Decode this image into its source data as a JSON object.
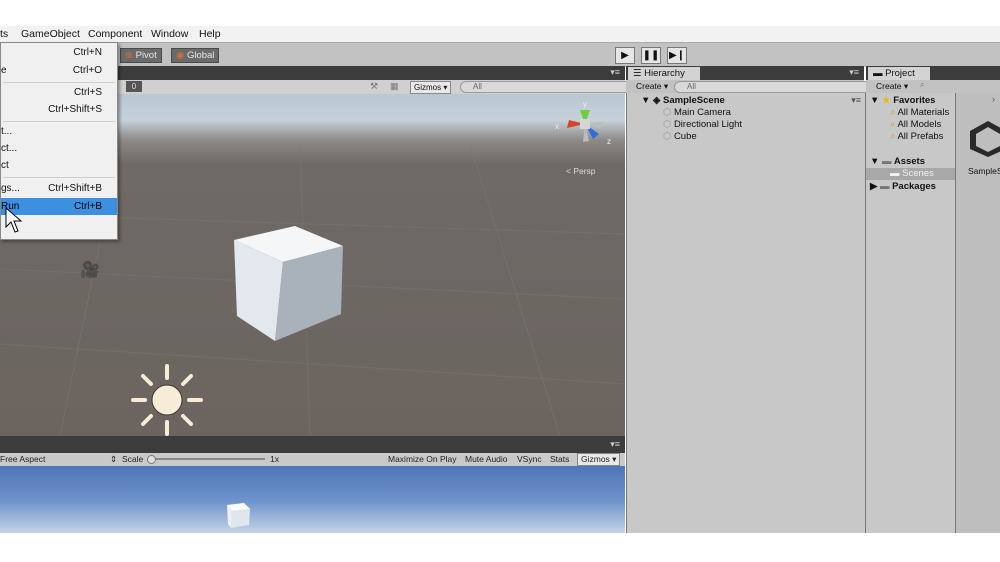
{
  "menubar": {
    "items": [
      "ts",
      "GameObject",
      "Component",
      "Window",
      "Help"
    ]
  },
  "toolbar": {
    "pivot_label": "Pivot",
    "global_label": "Global"
  },
  "file_menu": {
    "items": [
      {
        "label": "",
        "shortcut": "Ctrl+N"
      },
      {
        "label": "e",
        "shortcut": "Ctrl+O"
      },
      {
        "label": "",
        "shortcut": "Ctrl+S"
      },
      {
        "label": "",
        "shortcut": "Ctrl+Shift+S"
      },
      {
        "label": "t...",
        "shortcut": ""
      },
      {
        "label": "ct...",
        "shortcut": ""
      },
      {
        "label": "ct",
        "shortcut": ""
      },
      {
        "label": "gs...",
        "shortcut": "Ctrl+Shift+B"
      },
      {
        "label": "Run",
        "shortcut": "Ctrl+B"
      }
    ]
  },
  "scene": {
    "toolbar_field": "0",
    "gizmos_label": "Gizmos",
    "search_placeholder": "All",
    "persp_label": "< Persp",
    "axis_y": "y",
    "axis_x": "x",
    "axis_z": "z"
  },
  "game": {
    "aspect": "Free Aspect",
    "scale_label": "Scale",
    "scale_value": "1x",
    "maximize_label": "Maximize On Play",
    "mute_label": "Mute Audio",
    "vsync_label": "VSync",
    "stats_label": "Stats",
    "gizmos_label": "Gizmos"
  },
  "hierarchy": {
    "tab_label": "Hierarchy",
    "create_label": "Create",
    "search_placeholder": "All",
    "scene_name": "SampleScene",
    "objects": [
      "Main Camera",
      "Directional Light",
      "Cube"
    ]
  },
  "project": {
    "tab_label": "Project",
    "create_label": "Create",
    "favorites_label": "Favorites",
    "favorites": [
      "All Materials",
      "All Models",
      "All Prefabs"
    ],
    "assets_label": "Assets",
    "scenes_label": "Scenes",
    "packages_label": "Packages",
    "grid_item": "SampleS"
  },
  "colors": {
    "selection": "#3d8fe0",
    "dark_tab": "#3c3c3c",
    "panel": "#c8c8c8"
  }
}
